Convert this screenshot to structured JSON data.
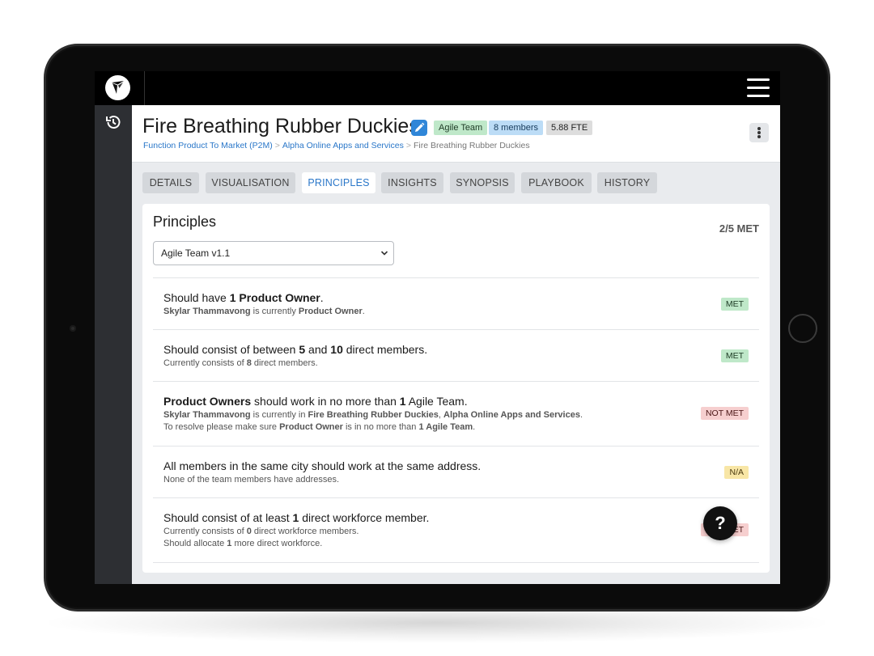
{
  "header": {
    "title": "Fire Breathing Rubber Duckies",
    "badges": {
      "team": "Agile Team",
      "members": "8 members",
      "fte": "5.88 FTE"
    },
    "breadcrumb": [
      "Function Product To Market (P2M)",
      "Alpha Online Apps and Services",
      "Fire Breathing Rubber Duckies"
    ]
  },
  "tabs": [
    {
      "label": "DETAILS"
    },
    {
      "label": "VISUALISATION"
    },
    {
      "label": "PRINCIPLES"
    },
    {
      "label": "INSIGHTS"
    },
    {
      "label": "SYNOPSIS"
    },
    {
      "label": "PLAYBOOK"
    },
    {
      "label": "HISTORY"
    }
  ],
  "active_tab": "PRINCIPLES",
  "panel": {
    "title": "Principles",
    "met_summary": "2/5 MET",
    "select_value": "Agile Team v1.1"
  },
  "rules": [
    {
      "main": [
        [
          "",
          "Should have "
        ],
        [
          "b",
          "1 Product Owner"
        ],
        [
          "",
          "."
        ]
      ],
      "subs": [
        [
          [
            "b",
            "Skylar Thammavong"
          ],
          [
            "",
            " is currently "
          ],
          [
            "b",
            "Product Owner"
          ],
          [
            "",
            "."
          ]
        ]
      ],
      "status": "MET",
      "status_type": "met"
    },
    {
      "main": [
        [
          "",
          "Should consist of between "
        ],
        [
          "b",
          "5"
        ],
        [
          "",
          " and "
        ],
        [
          "b",
          "10"
        ],
        [
          "",
          " direct members."
        ]
      ],
      "subs": [
        [
          [
            "",
            "Currently consists of "
          ],
          [
            "b",
            "8"
          ],
          [
            "",
            " direct members."
          ]
        ]
      ],
      "status": "MET",
      "status_type": "met"
    },
    {
      "main": [
        [
          "b",
          "Product Owners"
        ],
        [
          "",
          " should work in no more than "
        ],
        [
          "b",
          "1"
        ],
        [
          "",
          " Agile Team."
        ]
      ],
      "subs": [
        [
          [
            "b",
            "Skylar Thammavong"
          ],
          [
            "",
            " is currently in "
          ],
          [
            "b",
            "Fire Breathing Rubber Duckies"
          ],
          [
            "",
            ", "
          ],
          [
            "b",
            "Alpha Online Apps and Services"
          ],
          [
            "",
            "."
          ]
        ],
        [
          [
            "",
            "To resolve please make sure "
          ],
          [
            "b",
            "Product Owner"
          ],
          [
            "",
            " is in no more than "
          ],
          [
            "b",
            "1 Agile Team"
          ],
          [
            "",
            "."
          ]
        ]
      ],
      "status": "NOT MET",
      "status_type": "notmet"
    },
    {
      "main": [
        [
          "",
          "All members in the same city should work at the same address."
        ]
      ],
      "subs": [
        [
          [
            "",
            "None of the team members have addresses."
          ]
        ]
      ],
      "status": "N/A",
      "status_type": "na"
    },
    {
      "main": [
        [
          "",
          "Should consist of at least "
        ],
        [
          "b",
          "1"
        ],
        [
          "",
          " direct workforce member."
        ]
      ],
      "subs": [
        [
          [
            "",
            "Currently consists of "
          ],
          [
            "b",
            "0"
          ],
          [
            "",
            " direct workforce members."
          ]
        ],
        [
          [
            "",
            "Should allocate "
          ],
          [
            "b",
            "1"
          ],
          [
            "",
            " more direct workforce."
          ]
        ]
      ],
      "status": "NOT MET",
      "status_type": "notmet"
    }
  ],
  "help": {
    "label": "?"
  },
  "colors": {
    "accent": "#2a77c9",
    "met": "#bfe8c9",
    "not_met": "#f6cfcf",
    "na": "#f8e6a6",
    "edit_button": "#2f86d8"
  },
  "icons": {
    "logo": "logo-icon",
    "menu": "hamburger-menu-icon",
    "history": "history-icon",
    "edit": "pencil-icon",
    "more": "kebab-menu-icon",
    "dropdown": "chevron-down-icon",
    "help": "help-icon"
  }
}
